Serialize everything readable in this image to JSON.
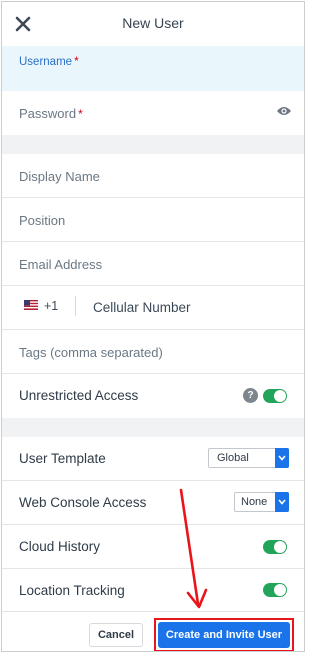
{
  "header": {
    "title": "New User",
    "close_icon": "close-icon"
  },
  "form": {
    "username_label": "Username",
    "password_label": "Password",
    "required_mark": "*",
    "display_name_placeholder": "Display Name",
    "position_placeholder": "Position",
    "email_placeholder": "Email Address",
    "phone": {
      "flag": "us-flag-icon",
      "country_code": "+1",
      "placeholder": "Cellular Number"
    },
    "tags_placeholder": "Tags (comma separated)",
    "unrestricted_access": {
      "label": "Unrestricted Access",
      "help": "?",
      "on": true
    }
  },
  "settings": {
    "user_template": {
      "label": "User Template",
      "value": "Global"
    },
    "web_console_access": {
      "label": "Web Console Access",
      "value": "None"
    },
    "cloud_history": {
      "label": "Cloud History",
      "on": true
    },
    "location_tracking": {
      "label": "Location Tracking",
      "on": true
    }
  },
  "footer": {
    "cancel_label": "Cancel",
    "submit_label": "Create and Invite User"
  },
  "colors": {
    "accent": "#1a73e8",
    "toggle_on": "#22a55a",
    "annotation": "#e8151b",
    "focus_bg": "#e9f7fd"
  }
}
